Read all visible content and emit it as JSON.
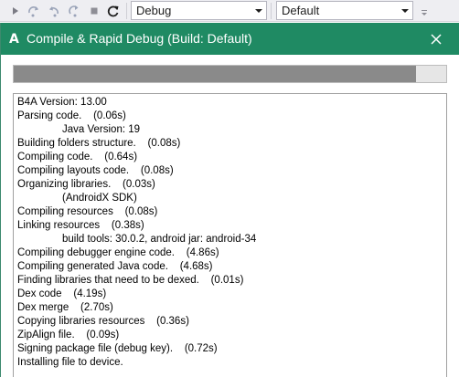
{
  "toolbar": {
    "build_config": "Debug",
    "device_target": "Default",
    "icons": [
      "run-icon",
      "step-over-icon",
      "step-back-icon",
      "stop-icon",
      "restart-icon"
    ]
  },
  "dialog": {
    "app_icon_letter": "A",
    "title": "Compile & Rapid Debug (Build: Default)",
    "accent_color": "#1f8a63",
    "progress": 0.93,
    "log": [
      {
        "text": "B4A Version: 13.00",
        "indent": false
      },
      {
        "text": "Parsing code.    (0.06s)",
        "indent": false
      },
      {
        "text": "Java Version: 19",
        "indent": true
      },
      {
        "text": "Building folders structure.    (0.08s)",
        "indent": false
      },
      {
        "text": "Compiling code.    (0.64s)",
        "indent": false
      },
      {
        "text": "Compiling layouts code.    (0.08s)",
        "indent": false
      },
      {
        "text": "Organizing libraries.    (0.03s)",
        "indent": false
      },
      {
        "text": "(AndroidX SDK)",
        "indent": true
      },
      {
        "text": "Compiling resources    (0.08s)",
        "indent": false
      },
      {
        "text": "Linking resources    (0.38s)",
        "indent": false
      },
      {
        "text": "build tools: 30.0.2, android jar: android-34",
        "indent": true
      },
      {
        "text": "Compiling debugger engine code.    (4.86s)",
        "indent": false
      },
      {
        "text": "Compiling generated Java code.    (4.68s)",
        "indent": false
      },
      {
        "text": "Finding libraries that need to be dexed.    (0.01s)",
        "indent": false
      },
      {
        "text": "Dex code    (4.19s)",
        "indent": false
      },
      {
        "text": "Dex merge    (2.70s)",
        "indent": false
      },
      {
        "text": "Copying libraries resources    (0.36s)",
        "indent": false
      },
      {
        "text": "ZipAlign file.    (0.09s)",
        "indent": false
      },
      {
        "text": "Signing package file (debug key).    (0.72s)",
        "indent": false
      },
      {
        "text": "Installing file to device.",
        "indent": false
      }
    ]
  }
}
